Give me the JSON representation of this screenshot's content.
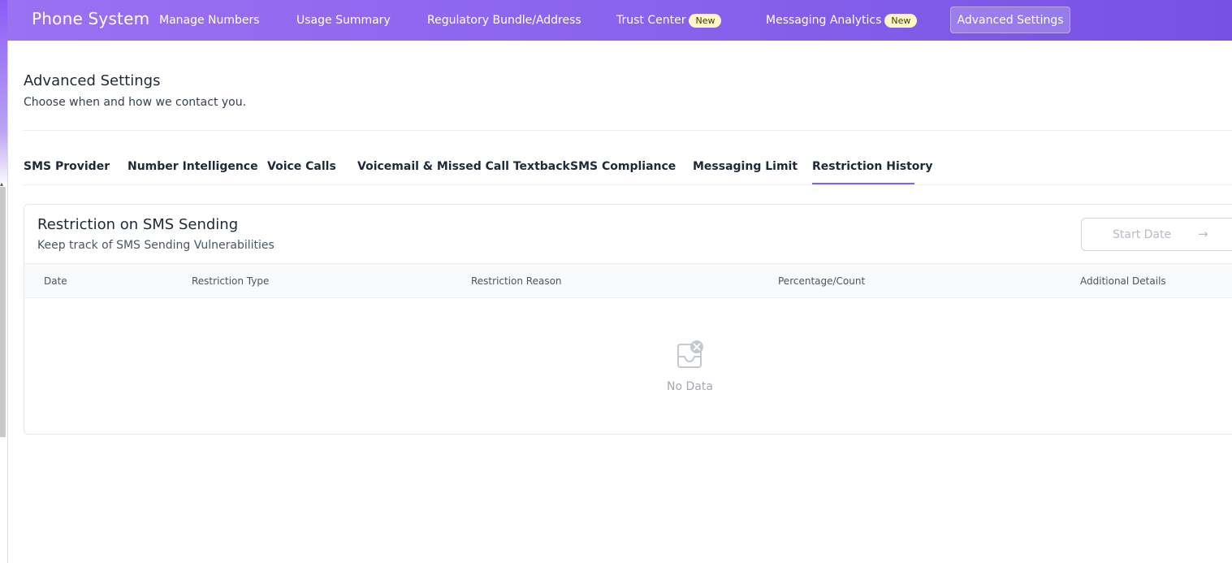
{
  "app": {
    "brand": "Phone System"
  },
  "nav": {
    "items": [
      {
        "label": "Manage Numbers"
      },
      {
        "label": "Usage Summary"
      },
      {
        "label": "Regulatory Bundle/Address"
      },
      {
        "label": "Trust Center",
        "badge": "New"
      },
      {
        "label": "Messaging Analytics",
        "badge": "New"
      },
      {
        "label": "Advanced Settings",
        "active": true
      }
    ]
  },
  "page": {
    "title": "Advanced Settings",
    "subtitle": "Choose when and how we contact you."
  },
  "tabs": {
    "items": [
      {
        "label": "SMS Provider"
      },
      {
        "label": "Number Intelligence"
      },
      {
        "label": "Voice Calls"
      },
      {
        "label": "Voicemail & Missed Call Textback"
      },
      {
        "label": "SMS Compliance"
      },
      {
        "label": "Messaging Limit"
      },
      {
        "label": "Restriction History",
        "active": true
      }
    ],
    "accent_color": "#8b5cf6"
  },
  "card": {
    "title": "Restriction on SMS Sending",
    "subtitle": "Keep track of SMS Sending Vulnerabilities",
    "date_picker": {
      "placeholder": "Start Date",
      "icon": "arrow-right-icon"
    },
    "table": {
      "columns": [
        "Date",
        "Restriction Type",
        "Restriction Reason",
        "Percentage/Count",
        "Additional Details"
      ],
      "rows": []
    },
    "empty": {
      "icon": "empty-inbox-icon",
      "text": "No Data"
    }
  },
  "colors": {
    "header_gradient_start": "#9b71f2",
    "header_gradient_end": "#7651e3",
    "badge_bg": "#fdf6c6"
  }
}
